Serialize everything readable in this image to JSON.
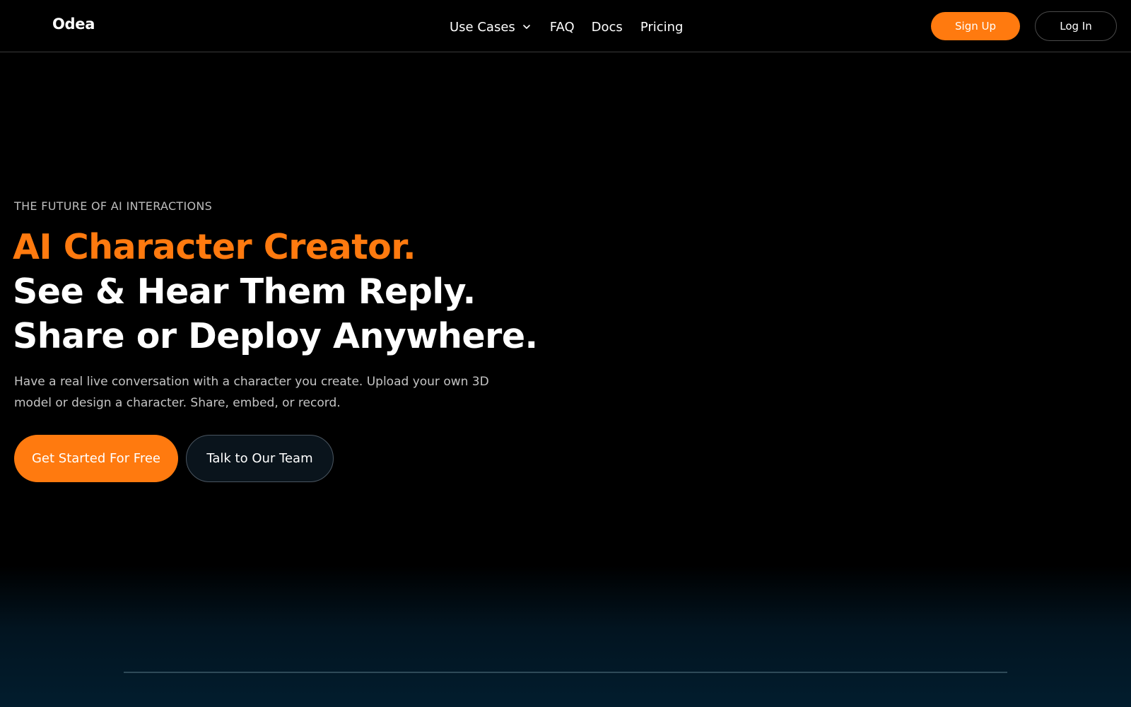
{
  "header": {
    "logo": "Odea",
    "nav": {
      "use_cases": "Use Cases",
      "faq": "FAQ",
      "docs": "Docs",
      "pricing": "Pricing"
    },
    "sign_up": "Sign Up",
    "log_in": "Log In"
  },
  "hero": {
    "eyebrow": "THE FUTURE OF AI INTERACTIONS",
    "headline": {
      "line1": "AI Character Creator.",
      "line2": "See & Hear Them Reply.",
      "line3": "Share or Deploy Anywhere."
    },
    "subtext": "Have a real live conversation with a character you create. Upload your own 3D model or design a character. Share, embed, or record.",
    "primary_cta": "Get Started For Free",
    "secondary_cta": "Talk to Our Team"
  },
  "colors": {
    "accent": "#ff7a0f",
    "background": "#000000",
    "bottom_gradient": "#021d2e"
  },
  "icons": {
    "use_cases_dropdown": "chevron-down-icon"
  }
}
